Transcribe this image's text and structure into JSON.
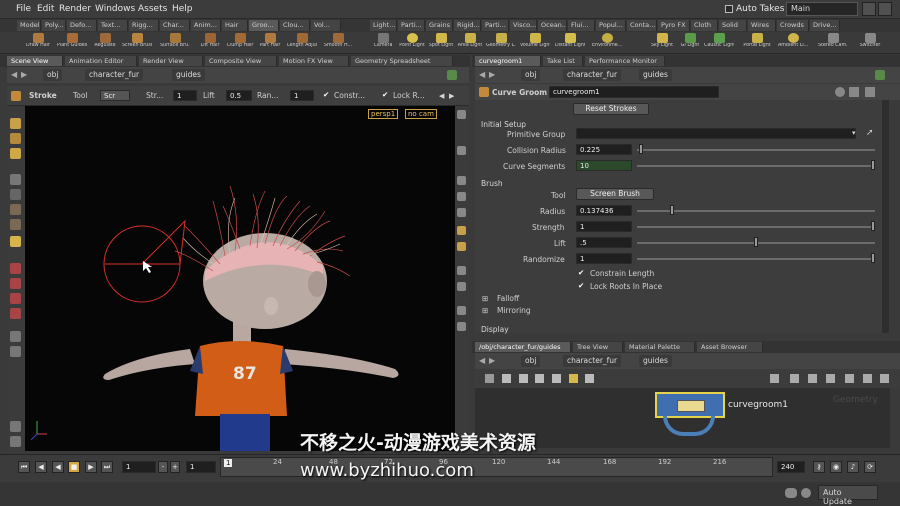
{
  "menubar": {
    "items": [
      "File",
      "Edit",
      "Render",
      "Windows",
      "Assets",
      "Help"
    ],
    "auto_takes": "Auto Takes",
    "desktop": "Main"
  },
  "shelf_tabs_left": [
    "Model",
    "Poly...",
    "Defo...",
    "Text...",
    "Rigg...",
    "Char...",
    "Anim...",
    "Hair",
    "Groo...",
    "Clou...",
    "Vol..."
  ],
  "shelf_tabs_right": [
    "Light...",
    "Parti...",
    "Grains",
    "Rigid...",
    "Parti...",
    "Visco...",
    "Ocean...",
    "Flui...",
    "Popul...",
    "Conta...",
    "Pyro FX",
    "Cloth",
    "Solid",
    "Wires",
    "Crowds",
    "Drive..."
  ],
  "shelf_tools_left": [
    "Draw Hair",
    "Plant Guides",
    "Regulate",
    "Screen Brush",
    "Surface Bru...",
    "Lift Hair",
    "Clump Hair",
    "Part Hair",
    "Length Adjust",
    "Smooth H..."
  ],
  "shelf_tools_right": [
    "Camera",
    "Point Light",
    "Spot Light",
    "Area Light",
    "Geometry L...",
    "Volume Light",
    "Distant Light",
    "Environme...",
    "Sky Light",
    "GI Light",
    "Caustic Light",
    "Portal Light",
    "Ambient Li...",
    "Stereo Cam...",
    "Switcher"
  ],
  "left_pane": {
    "tabs": [
      "Scene View",
      "Animation Editor",
      "Render View",
      "Composite View",
      "Motion FX View",
      "Geometry Spreadsheet"
    ],
    "path": [
      "obj",
      "character_fur",
      "guides"
    ],
    "tool_options": {
      "state": "Stroke",
      "tool_label": "Tool",
      "tool_value": "Scr",
      "strength_label": "Str...",
      "strength_value": "1",
      "lift_label": "Lift",
      "lift_value": "0.5",
      "randomize_label": "Ran...",
      "randomize_value": "1",
      "constrain_label": "Constr...",
      "lock_roots_label": "Lock R..."
    },
    "viewport": {
      "camera": "persp1",
      "cam_menu": "no cam",
      "shirt_number": "87"
    }
  },
  "right_pane": {
    "tabs": [
      "curvegroom1",
      "Take List",
      "Performance Monitor"
    ],
    "path": [
      "obj",
      "character_fur",
      "guides"
    ],
    "node_type": "Curve Groom",
    "node_name": "curvegroom1",
    "reset_button": "Reset Strokes",
    "initial_setup": "Initial Setup",
    "primitive_group_label": "Primitive Group",
    "primitive_group_value": "",
    "collision_radius_label": "Collision Radius",
    "collision_radius": "0.225",
    "curve_segments_label": "Curve Segments",
    "curve_segments": "10",
    "brush_section": "Brush",
    "tool_label": "Tool",
    "tool_value": "Screen Brush",
    "radius_label": "Radius",
    "radius": "0.137436",
    "strength_label": "Strength",
    "strength": "1",
    "lift_label": "Lift",
    "lift": ".5",
    "randomize_label": "Randomize",
    "randomize": "1",
    "constrain_length": "Constrain Length",
    "lock_roots": "Lock Roots In Place",
    "falloff": "Falloff",
    "mirroring": "Mirroring",
    "display": "Display",
    "sliders": {
      "collision": 0.01,
      "segments": 1.0,
      "radius": 0.14,
      "strength": 1.0,
      "lift": 0.5,
      "randomize": 1.0
    }
  },
  "network": {
    "tabs": [
      "/obj/character_fur/guides",
      "Tree View",
      "Material Palette",
      "Asset Browser"
    ],
    "path": [
      "obj",
      "character_fur",
      "guides"
    ],
    "node_label": "curvegroom1",
    "context": "Geometry"
  },
  "timeline": {
    "current_frame": "1",
    "start": "1",
    "end": "240",
    "ticks": [
      "1",
      "24",
      "48",
      "72",
      "96",
      "120",
      "144",
      "168",
      "192",
      "216"
    ]
  },
  "status": {
    "auto_update": "Auto Update"
  },
  "watermark": {
    "title": "不移之火-动漫游戏美术资源",
    "url": "www.byzhihuo.com"
  }
}
